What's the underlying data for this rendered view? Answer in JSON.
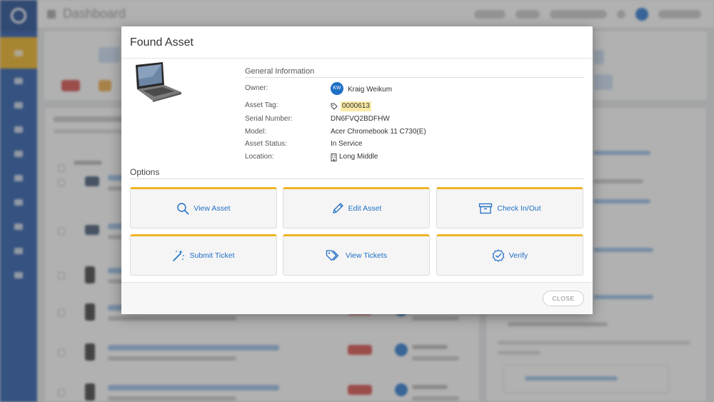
{
  "background": {
    "header_title": "Dashboard"
  },
  "modal": {
    "title": "Found Asset",
    "general_information_heading": "General Information",
    "fields": [
      {
        "label": "Owner:",
        "value": "Kraig Weikum",
        "initials": "KW"
      },
      {
        "label": "Asset Tag:",
        "value": "0000613"
      },
      {
        "label": "Serial Number:",
        "value": "DN6FVQ2BDFHW"
      },
      {
        "label": "Model:",
        "value": "Acer Chromebook 11 C730(E)"
      },
      {
        "label": "Asset Status:",
        "value": "In Service"
      },
      {
        "label": "Location:",
        "value": "Long Middle"
      }
    ],
    "options_heading": "Options",
    "options": [
      {
        "label": "View Asset",
        "icon": "search-icon"
      },
      {
        "label": "Edit Asset",
        "icon": "pencil-icon"
      },
      {
        "label": "Check In/Out",
        "icon": "archive-box-icon"
      },
      {
        "label": "Submit Ticket",
        "icon": "magic-wand-icon"
      },
      {
        "label": "View Tickets",
        "icon": "tags-icon"
      },
      {
        "label": "Verify",
        "icon": "verified-badge-icon"
      }
    ],
    "close_label": "CLOSE"
  },
  "colors": {
    "accent": "#f0b323",
    "link": "#1f6fc5",
    "sidebar": "#2b5cab"
  }
}
